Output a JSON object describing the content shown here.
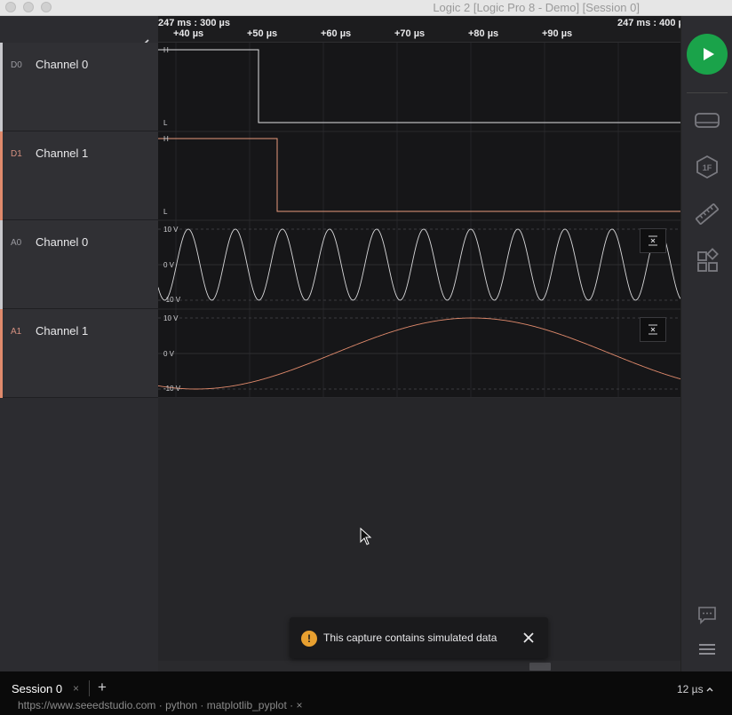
{
  "window": {
    "title": "Logic 2 [Logic Pro 8 - Demo] [Session 0]"
  },
  "channels": [
    {
      "code": "D0",
      "name": "Channel 0",
      "color": "#c8c8cc",
      "code_color": "#9a9aa0"
    },
    {
      "code": "D1",
      "name": "Channel 1",
      "color": "#e08a6c",
      "code_color": "#d49080"
    },
    {
      "code": "A0",
      "name": "Channel 0",
      "color": "#c8c8cc",
      "code_color": "#9a9aa0"
    },
    {
      "code": "A1",
      "name": "Channel 1",
      "color": "#e08a6c",
      "code_color": "#d49080"
    }
  ],
  "timeline": {
    "start_label": "247 ms : 300 µs",
    "end_label": "247 ms : 400 µ",
    "ticks": [
      "+40 µs",
      "+50 µs",
      "+60 µs",
      "+70 µs",
      "+80 µs",
      "+90 µs"
    ]
  },
  "digital_levels": {
    "high": "H",
    "low": "L"
  },
  "analog_levels": {
    "top": "10 V",
    "mid": "0 V",
    "bottom": "-10 V"
  },
  "toast": {
    "icon": "!",
    "message": "This capture contains simulated data"
  },
  "bottom": {
    "session_tab": "Session 0",
    "session_close": "×",
    "add_tab": "+",
    "zoom_level": "12 µs",
    "cutoff_text": "https://www.seeedstudio.com · python · matplotlib_pyplot · ×"
  },
  "colors": {
    "play": "#1aa34a",
    "accent_orange": "#e08a6c",
    "warning": "#e8a030"
  },
  "icons": [
    "play-icon",
    "device-icon",
    "analyzer-icon",
    "measure-icon",
    "extensions-icon",
    "comment-icon",
    "menu-icon"
  ]
}
